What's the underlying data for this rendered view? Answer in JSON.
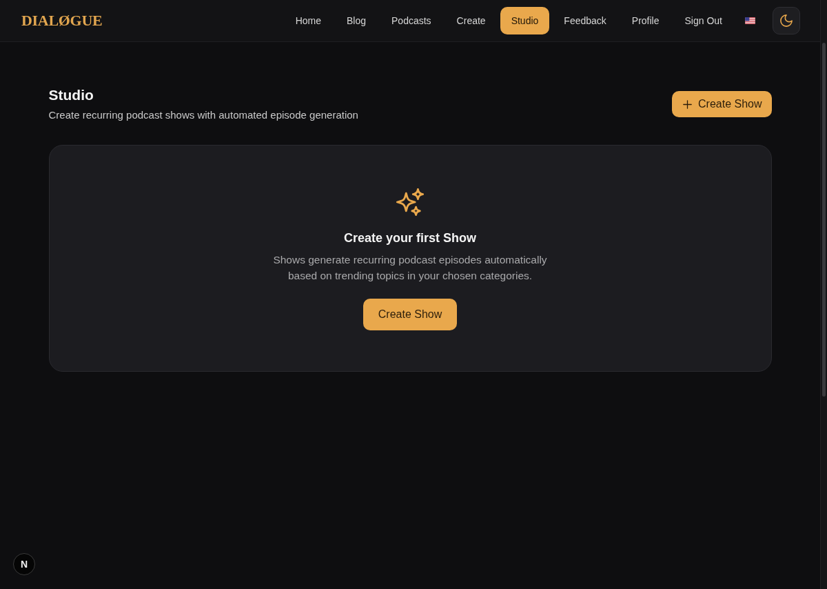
{
  "header": {
    "logo": "DIALØGUE",
    "nav": [
      {
        "label": "Home",
        "selected": false
      },
      {
        "label": "Blog",
        "selected": false
      },
      {
        "label": "Podcasts",
        "selected": false
      },
      {
        "label": "Create",
        "selected": false
      },
      {
        "label": "Studio",
        "selected": true
      },
      {
        "label": "Feedback",
        "selected": false
      },
      {
        "label": "Profile",
        "selected": false
      },
      {
        "label": "Sign Out",
        "selected": false
      }
    ]
  },
  "page": {
    "title": "Studio",
    "subtitle": "Create recurring podcast shows with automated episode generation",
    "action": {
      "label": "Create Show"
    }
  },
  "empty_state": {
    "title": "Create your first Show",
    "description": "Shows generate recurring podcast episodes automatically based on trending topics in your chosen categories.",
    "button": {
      "label": "Create Show"
    }
  },
  "dev_tools": {
    "label": "N"
  }
}
